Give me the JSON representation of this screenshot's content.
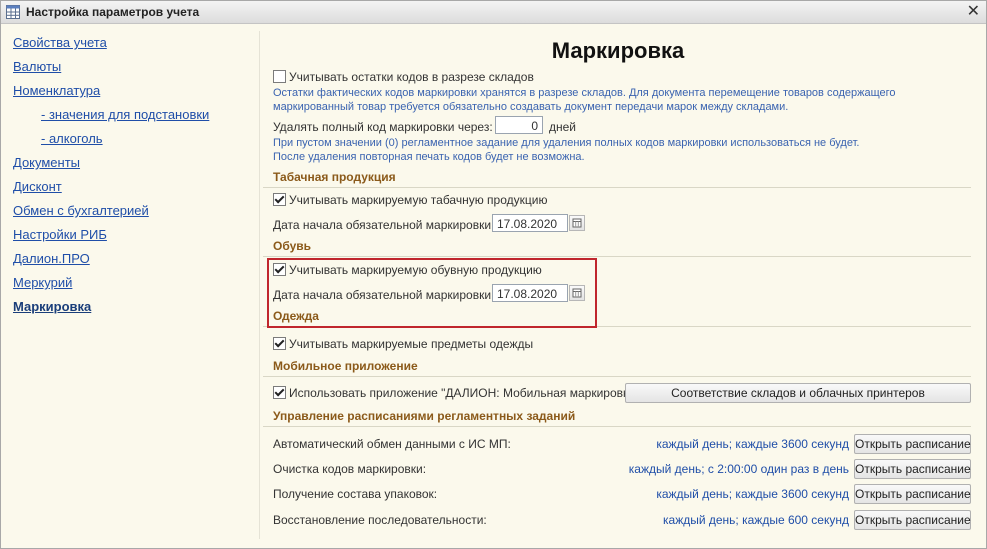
{
  "window": {
    "title": "Настройка параметров учета"
  },
  "sidebar": {
    "items": [
      {
        "label": "Свойства учета"
      },
      {
        "label": "Валюты"
      },
      {
        "label": "Номенклатура"
      },
      {
        "label": "- значения для подстановки"
      },
      {
        "label": "- алкоголь"
      },
      {
        "label": "Документы"
      },
      {
        "label": "Дисконт"
      },
      {
        "label": "Обмен с бухгалтерией"
      },
      {
        "label": "Настройки РИБ"
      },
      {
        "label": "Далион.ПРО"
      },
      {
        "label": "Меркурий"
      },
      {
        "label": "Маркировка"
      }
    ]
  },
  "main": {
    "heading": "Маркировка",
    "warehouse_checkbox": {
      "label": "Учитывать остатки кодов в разрезе складов",
      "checked": false
    },
    "warehouse_hint_1": "Остатки фактических кодов маркировки хранятся в разрезе складов. Для документа перемещение товаров содержащего",
    "warehouse_hint_2": "маркированный товар требуется обязательно создавать документ передачи марок между складами.",
    "delete_code": {
      "label": "Удалять полный код маркировки через:",
      "value": "0",
      "unit": "дней"
    },
    "delete_hint_1": "При пустом значении (0) регламентное задание для удаления полных кодов маркировки использоваться не будет.",
    "delete_hint_2": "После удаления повторная печать кодов будет не возможна.",
    "tobacco": {
      "title": "Табачная продукция",
      "checkbox": "Учитывать маркируемую табачную продукцию",
      "checked": true,
      "date_label": "Дата начала обязательной маркировки:",
      "date_value": "17.08.2020"
    },
    "shoes": {
      "title": "Обувь",
      "checkbox": "Учитывать маркируемую обувную продукцию",
      "checked": true,
      "date_label": "Дата начала обязательной маркировки:",
      "date_value": "17.08.2020"
    },
    "clothes": {
      "title": "Одежда",
      "checkbox": "Учитывать маркируемые предметы одежды",
      "checked": true
    },
    "mobile": {
      "title": "Мобильное приложение",
      "checkbox": "Использовать приложение \"ДАЛИОН: Мобильная маркировка\"",
      "checked": true,
      "button": "Соответствие складов и облачных принтеров"
    },
    "schedules": {
      "title": "Управление расписаниями регламентных заданий",
      "button_label": "Открыть расписание",
      "rows": [
        {
          "label": "Автоматический обмен данными с ИС МП:",
          "schedule": "каждый день; каждые 3600 секунд"
        },
        {
          "label": "Очистка кодов маркировки:",
          "schedule": "каждый день; с 2:00:00 один раз в день"
        },
        {
          "label": "Получение состава упаковок:",
          "schedule": "каждый день; каждые 3600 секунд"
        },
        {
          "label": "Восстановление последовательности:",
          "schedule": "каждый день; каждые 600 секунд"
        }
      ]
    }
  },
  "colors": {
    "highlight_border": "#c0262d",
    "section_title": "#8b5a1a",
    "link": "#1f4ea8",
    "background": "#fbf9ec"
  }
}
